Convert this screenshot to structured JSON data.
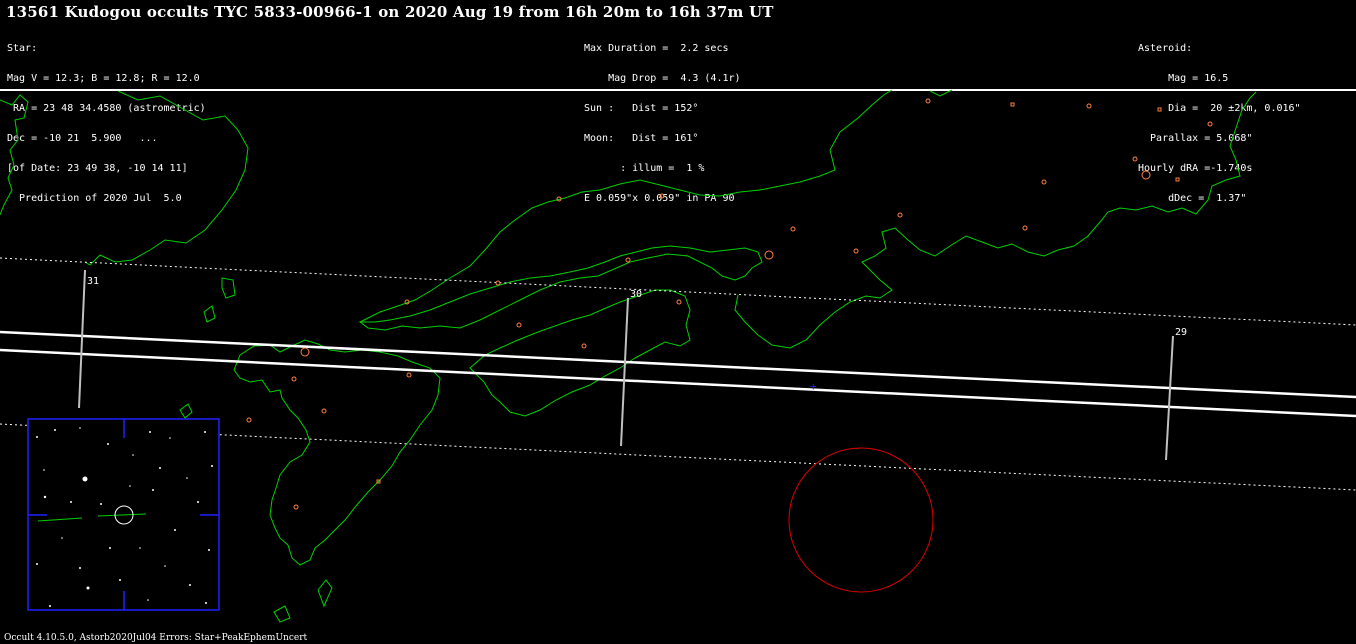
{
  "title": "13561 Kudogou occults TYC 5833-00966-1 on 2020 Aug 19 from 16h 20m to 16h 37m UT",
  "star_block": [
    "Star:",
    "Mag V = 12.3; B = 12.8; R = 12.0",
    " RA = 23 48 34.4580 (astrometric)",
    "Dec = -10 21  5.900   ...",
    "[of Date: 23 49 38, -10 14 11]",
    "  Prediction of 2020 Jul  5.0"
  ],
  "event_block": [
    "Max Duration =  2.2 secs",
    "    Mag Drop =  4.3 (4.1r)",
    "Sun :   Dist = 152°",
    "Moon:   Dist = 161°",
    "      : illum =  1 %",
    "E 0.059\"x 0.059\" in PA 90"
  ],
  "asteroid_block": [
    "Asteroid:",
    "     Mag = 16.5",
    "     Dia =  20 ±2km, 0.016\"",
    "  Parallax = 5.068\"",
    "Hourly dRA =-1.740s",
    "     dDec =  1.37\""
  ],
  "footer": "Occult 4.10.5.0, Astorb2020Jul04  Errors: Star+PeakEphemUncert",
  "time_ticks": [
    "31",
    "30",
    "29"
  ],
  "colors": {
    "background": "#000000",
    "coastline": "#00d000",
    "cities": "#ff8040",
    "path_lines": "#ffffff",
    "sky_circle": "#e00000",
    "inset_frame": "#2020ff",
    "center_marker": "#2020ff"
  }
}
